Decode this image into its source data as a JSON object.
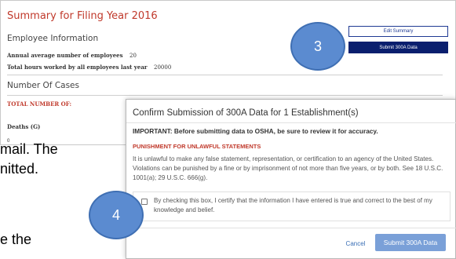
{
  "summary": {
    "title": "Summary for Filing Year 2016",
    "employee_heading": "Employee Information",
    "avg_employees_label": "Annual average number of employees",
    "avg_employees_value": "20",
    "total_hours_label": "Total hours worked by all employees last year",
    "total_hours_value": "20000",
    "cases_heading": "Number Of Cases",
    "total_number_label": "TOTAL NUMBER OF:",
    "deaths_label": "Deaths (G)",
    "deaths_value": "0"
  },
  "actions": {
    "edit_label": "Edit Summary",
    "submit_label": "Submit 300A Data"
  },
  "steps": {
    "step3": "3",
    "step4": "4"
  },
  "document": {
    "line1": "mail.  The",
    "line2": "nitted.",
    "line3": "e the"
  },
  "modal": {
    "title": "Confirm Submission of 300A Data for 1 Establishment(s)",
    "important": "IMPORTANT: Before submitting data to OSHA, be sure to review it for accuracy.",
    "punishment_heading": "PUNISHMENT FOR UNLAWFUL STATEMENTS",
    "body_text": "It is unlawful to make any false statement, representation, or certification to an agency of the United States. Violations can be punished by a fine or by imprisonment of not more than five years, or by both. See 18 U.S.C. 1001(a); 29 U.S.C. 666(g).",
    "certify_text": "By checking this box, I certify that the information I have entered is true and correct to the best of my knowledge and belief.",
    "cancel_label": "Cancel",
    "submit_label": "Submit 300A Data"
  }
}
